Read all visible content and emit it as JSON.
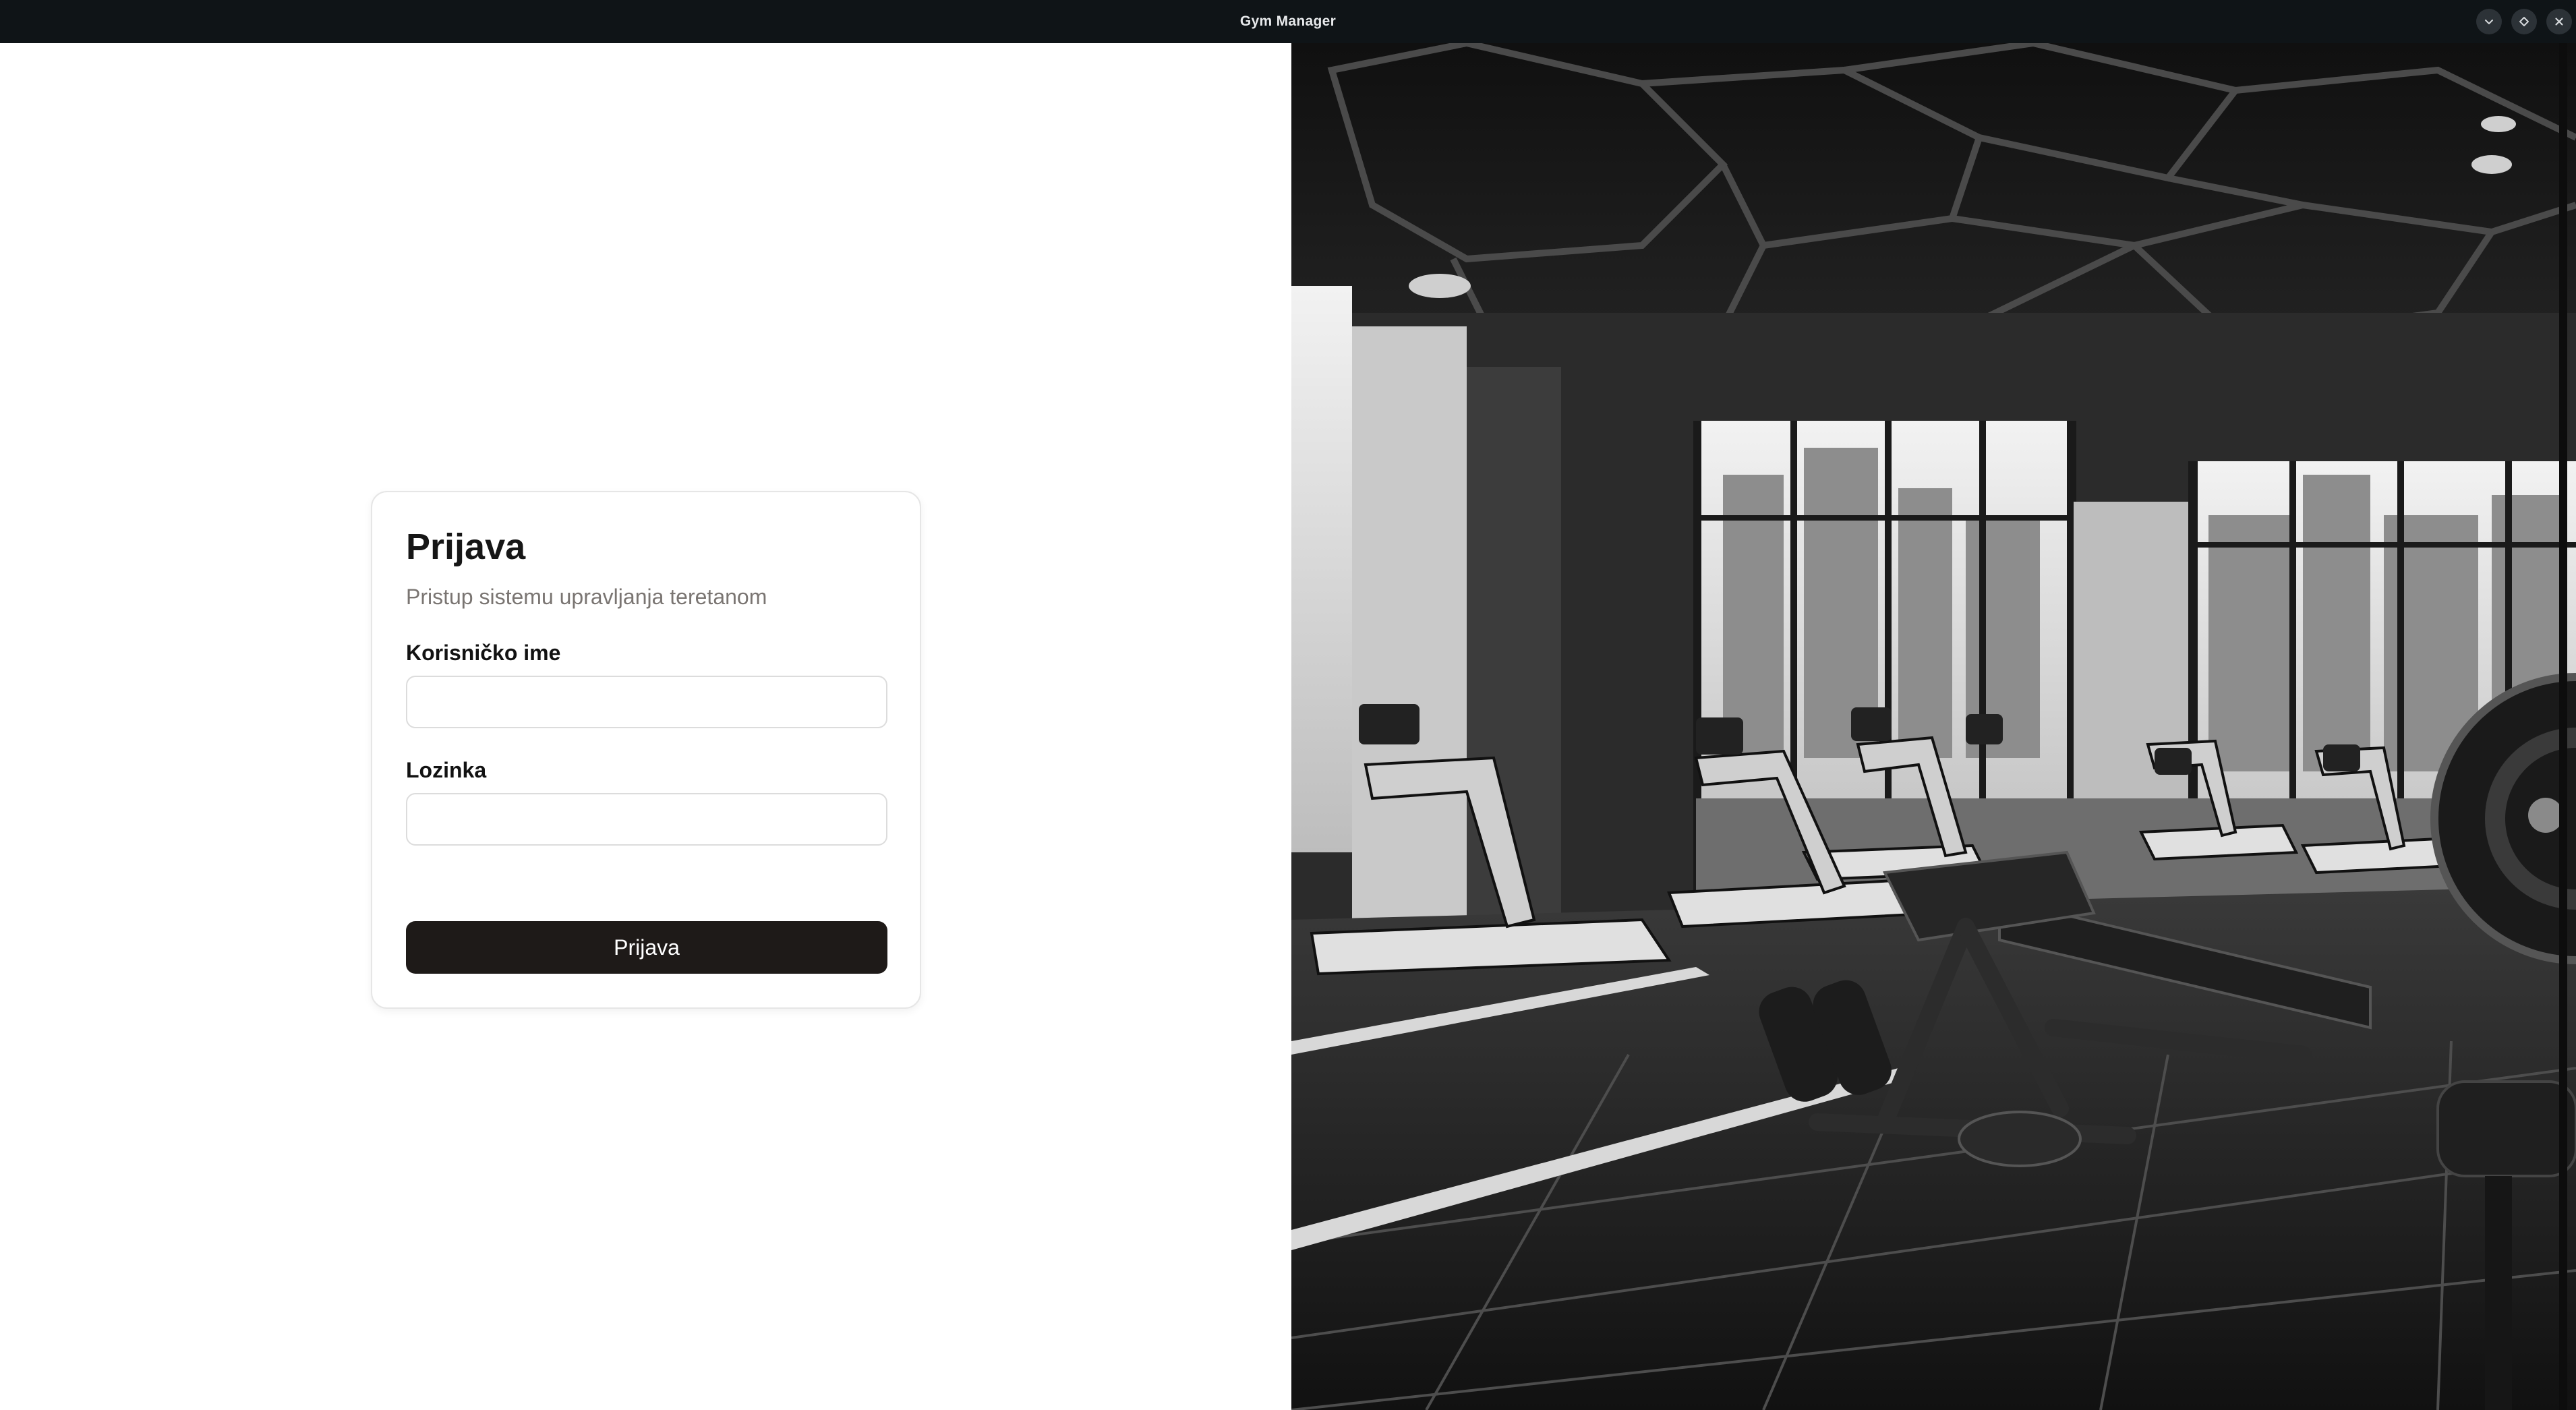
{
  "window": {
    "title": "Gym Manager",
    "controls": [
      {
        "name": "minimize",
        "icon": "chevron-down-icon"
      },
      {
        "name": "maximize",
        "icon": "diamond-icon"
      },
      {
        "name": "close",
        "icon": "close-icon"
      }
    ]
  },
  "login": {
    "title": "Prijava",
    "subtitle": "Pristup sistemu upravljanja teretanom",
    "username": {
      "label": "Korisničko ime",
      "value": "",
      "placeholder": ""
    },
    "password": {
      "label": "Lozinka",
      "value": "",
      "placeholder": ""
    },
    "submit_label": "Prijava"
  },
  "hero_image": {
    "subject": "gym-interior-photo",
    "style": "black-and-white"
  },
  "colors": {
    "titlebar_bg": "#0f1417",
    "button_bg": "#1e1a18",
    "subtitle_text": "#7a7572",
    "card_border": "#e6e6e6"
  }
}
